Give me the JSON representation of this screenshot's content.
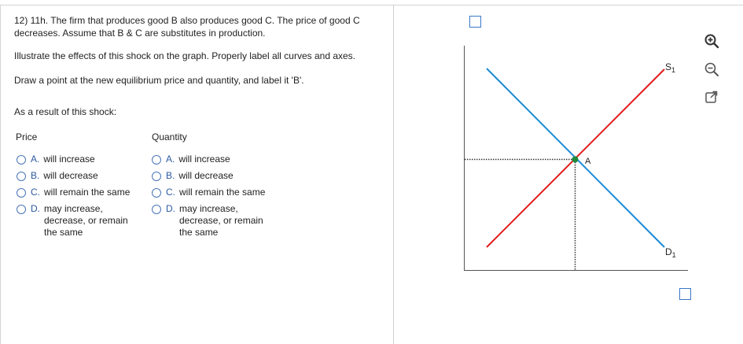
{
  "question": {
    "number": "12) 11h.",
    "text": "The firm that produces good B also produces good C.  The price of good C decreases.  Assume that B & C are substitutes in production."
  },
  "instructions": {
    "line1": "Illustrate the effects of this shock on the graph.  Properly label all curves and axes.",
    "line2": "Draw a point at the new equilibrium price and quantity, and label it 'B'."
  },
  "result_prompt": "As a result of this shock:",
  "price": {
    "header": "Price",
    "options": [
      {
        "letter": "A.",
        "lines": [
          "will increase"
        ]
      },
      {
        "letter": "B.",
        "lines": [
          "will decrease"
        ]
      },
      {
        "letter": "C.",
        "lines": [
          "will remain the same"
        ]
      },
      {
        "letter": "D.",
        "lines": [
          "may increase,",
          "decrease, or remain",
          "the same"
        ]
      }
    ]
  },
  "quantity": {
    "header": "Quantity",
    "options": [
      {
        "letter": "A.",
        "lines": [
          "will increase"
        ]
      },
      {
        "letter": "B.",
        "lines": [
          "will decrease"
        ]
      },
      {
        "letter": "C.",
        "lines": [
          "will remain the same"
        ]
      },
      {
        "letter": "D.",
        "lines": [
          "may increase,",
          "decrease, or remain",
          "the same"
        ]
      }
    ]
  },
  "graph": {
    "supply_label": "S",
    "supply_sub": "1",
    "demand_label": "D",
    "demand_sub": "1",
    "point_label": "A",
    "supply_color": "#e21b1b",
    "demand_color": "#1a8ad4",
    "point_color": "#1f8a3c"
  },
  "tools": [
    "zoom-in-icon",
    "zoom-out-icon",
    "expand-icon"
  ]
}
